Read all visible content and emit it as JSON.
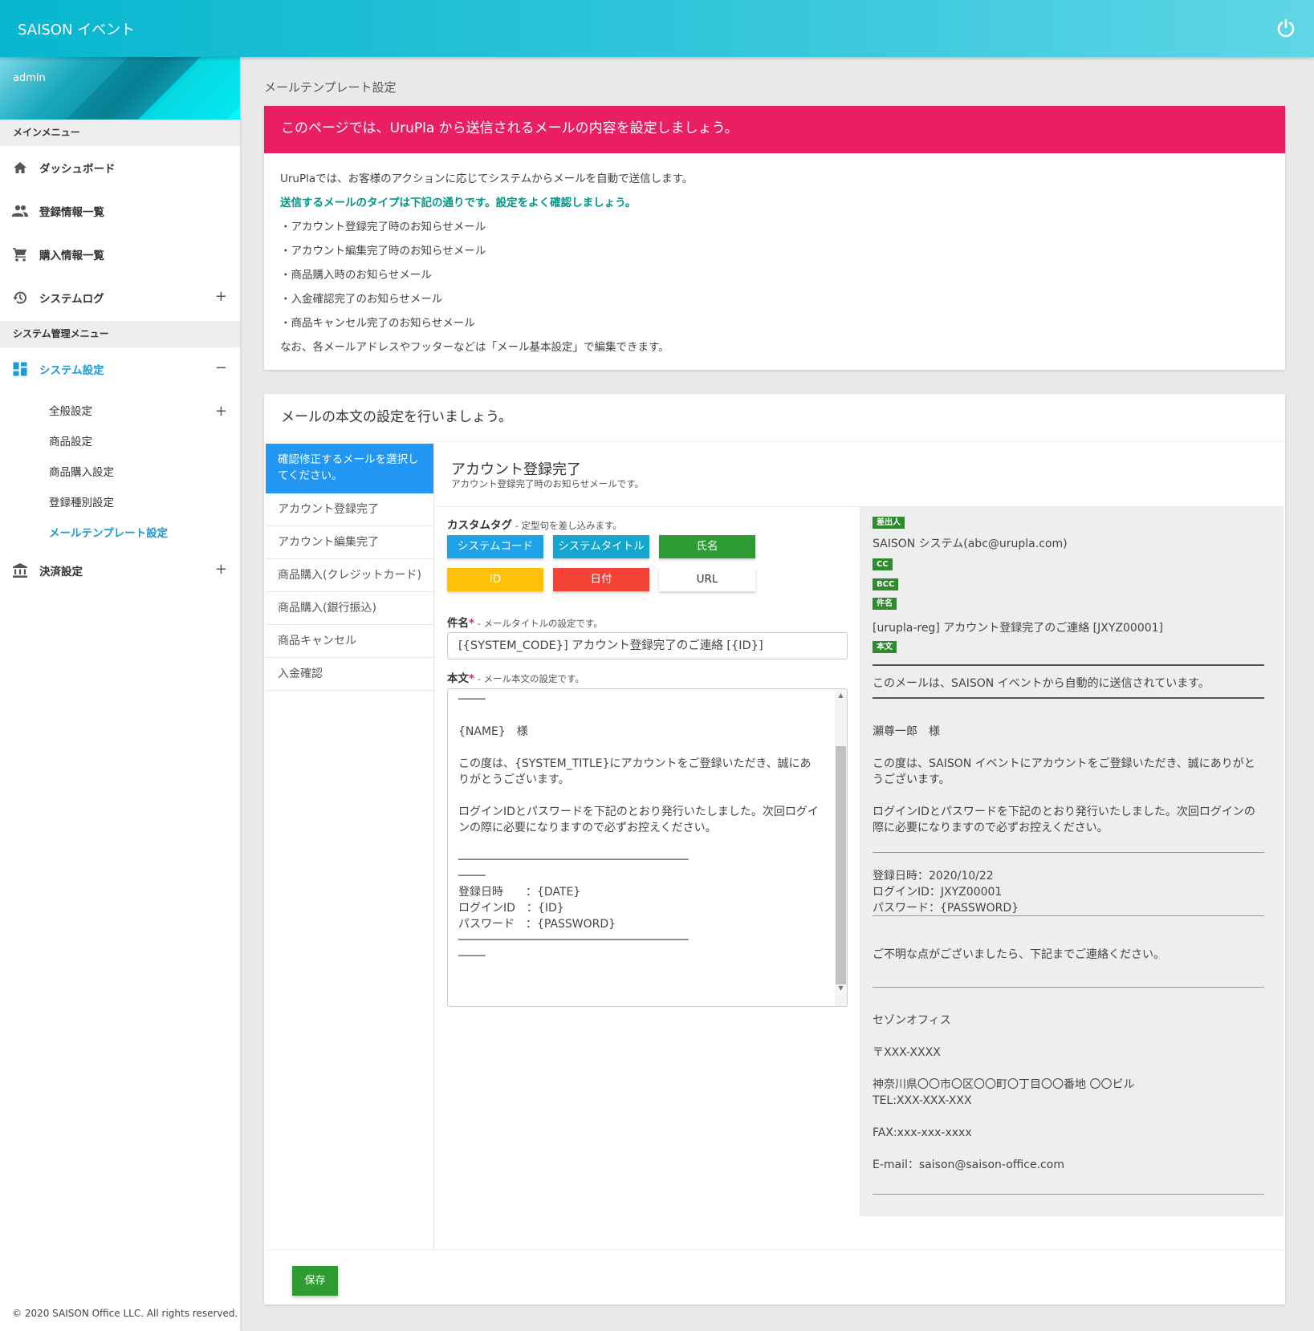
{
  "app": {
    "title": "SAISON イベント"
  },
  "user": {
    "name": "admin"
  },
  "sidebar": {
    "main_header": "メインメニュー",
    "main_items": [
      {
        "label": "ダッシュボード",
        "icon": "home-icon"
      },
      {
        "label": "登録情報一覧",
        "icon": "people-icon"
      },
      {
        "label": "購入情報一覧",
        "icon": "cart-icon"
      },
      {
        "label": "システムログ",
        "icon": "history-icon",
        "toggle": "+"
      }
    ],
    "admin_header": "システム管理メニュー",
    "system_settings": {
      "label": "システム設定",
      "icon": "dashboard-icon",
      "toggle": "−"
    },
    "sub_items": [
      {
        "label": "全般設定",
        "toggle": "+"
      },
      {
        "label": "商品設定"
      },
      {
        "label": "商品購入設定"
      },
      {
        "label": "登録種別設定"
      },
      {
        "label": "メールテンプレート設定"
      }
    ],
    "payment": {
      "label": "決済設定",
      "icon": "bank-icon",
      "toggle": "+"
    },
    "copyright": "© 2020 SAISON Office LLC. All rights reserved."
  },
  "page": {
    "title": "メールテンプレート設定"
  },
  "intro": {
    "heading": "このページでは、UruPla から送信されるメールの内容を設定しましょう。",
    "line1": "UruPlaでは、お客様のアクションに応じてシステムからメールを自動で送信します。",
    "highlight": "送信するメールのタイプは下記の通りです。設定をよく確認しましょう。",
    "types": [
      "・アカウント登録完了時のお知らせメール",
      "・アカウント編集完了時のお知らせメール",
      "・商品購入時のお知らせメール",
      "・入金確認完了のお知らせメール",
      "・商品キャンセル完了のお知らせメール"
    ],
    "note": "なお、各メールアドレスやフッターなどは「メール基本設定」で編集できます。"
  },
  "editor": {
    "heading": "メールの本文の設定を行いましょう。",
    "tab_header": "確認修正するメールを選択してください。",
    "tabs": [
      "アカウント登録完了",
      "アカウント編集完了",
      "商品購入(クレジットカード)",
      "商品購入(銀行振込)",
      "商品キャンセル",
      "入金確認"
    ],
    "template_title": "アカウント登録完了",
    "template_sub": "アカウント登録完了時のお知らせメールです。",
    "custom_tag_label": "カスタムタグ",
    "custom_tag_hint": " - 定型句を差し込みます。",
    "tags": [
      {
        "label": "システムコード",
        "color": "#1fa3e8"
      },
      {
        "label": "システムタイトル",
        "color": "#14a6cf"
      },
      {
        "label": "氏名",
        "color": "#2e9b33"
      },
      {
        "label": "ID",
        "color": "#ffc107"
      },
      {
        "label": "日付",
        "color": "#f44336"
      },
      {
        "label": "URL",
        "color": "#ffffff"
      }
    ],
    "subject_label": "件名",
    "subject_hint": " - メールタイトルの設定です。",
    "subject_value": "[{SYSTEM_CODE}] アカウント登録完了のご連絡 [{ID}]",
    "body_label": "本文",
    "body_hint": " - メール本文の設定です。",
    "body_value": "────\n\n{NAME}　様\n\nこの度は、{SYSTEM_TITLE}にアカウントをご登録いただき、誠にありがとうございます。\n\nログインIDとパスワードを下記のとおり発行いたしました。次回ログインの際に必要になりますので必ずお控えください。\n\n──────────────────────────────────\n────\n登録日時　　：{DATE}\nログインID　：{ID}\nパスワード　：{PASSWORD}\n──────────────────────────────────\n────",
    "required_mark": "*",
    "save_label": "保存"
  },
  "preview": {
    "from_label": "差出人",
    "from_value": "SAISON システム(abc@urupla.com)",
    "cc_label": "CC",
    "bcc_label": "BCC",
    "subject_label": "件名",
    "subject_value": "[urupla-reg] アカウント登録完了のご連絡 [JXYZ00001]",
    "body_label": "本文",
    "auto_notice": "このメールは、SAISON イベントから自動的に送信されています。",
    "greeting": "瀬尊一郎　様",
    "para1": "この度は、SAISON イベントにアカウントをご登録いただき、誠にありがとうございます。",
    "para2": "ログインIDとパスワードを下記のとおり発行いたしました。次回ログインの際に必要になりますので必ずお控えください。",
    "info": "登録日時：2020/10/22\nログインID：JXYZ00001\nパスワード：{PASSWORD}",
    "contact": "ご不明な点がございましたら、下記までご連絡ください。",
    "office": "セゾンオフィス",
    "zip": "〒XXX-XXXX",
    "address": "神奈川県〇〇市〇区〇〇町〇丁目〇〇番地 〇〇ビル\nTEL:XXX-XXX-XXX",
    "fax": "FAX:xxx-xxx-xxxx",
    "email": "E-mail：saison@saison-office.com"
  }
}
